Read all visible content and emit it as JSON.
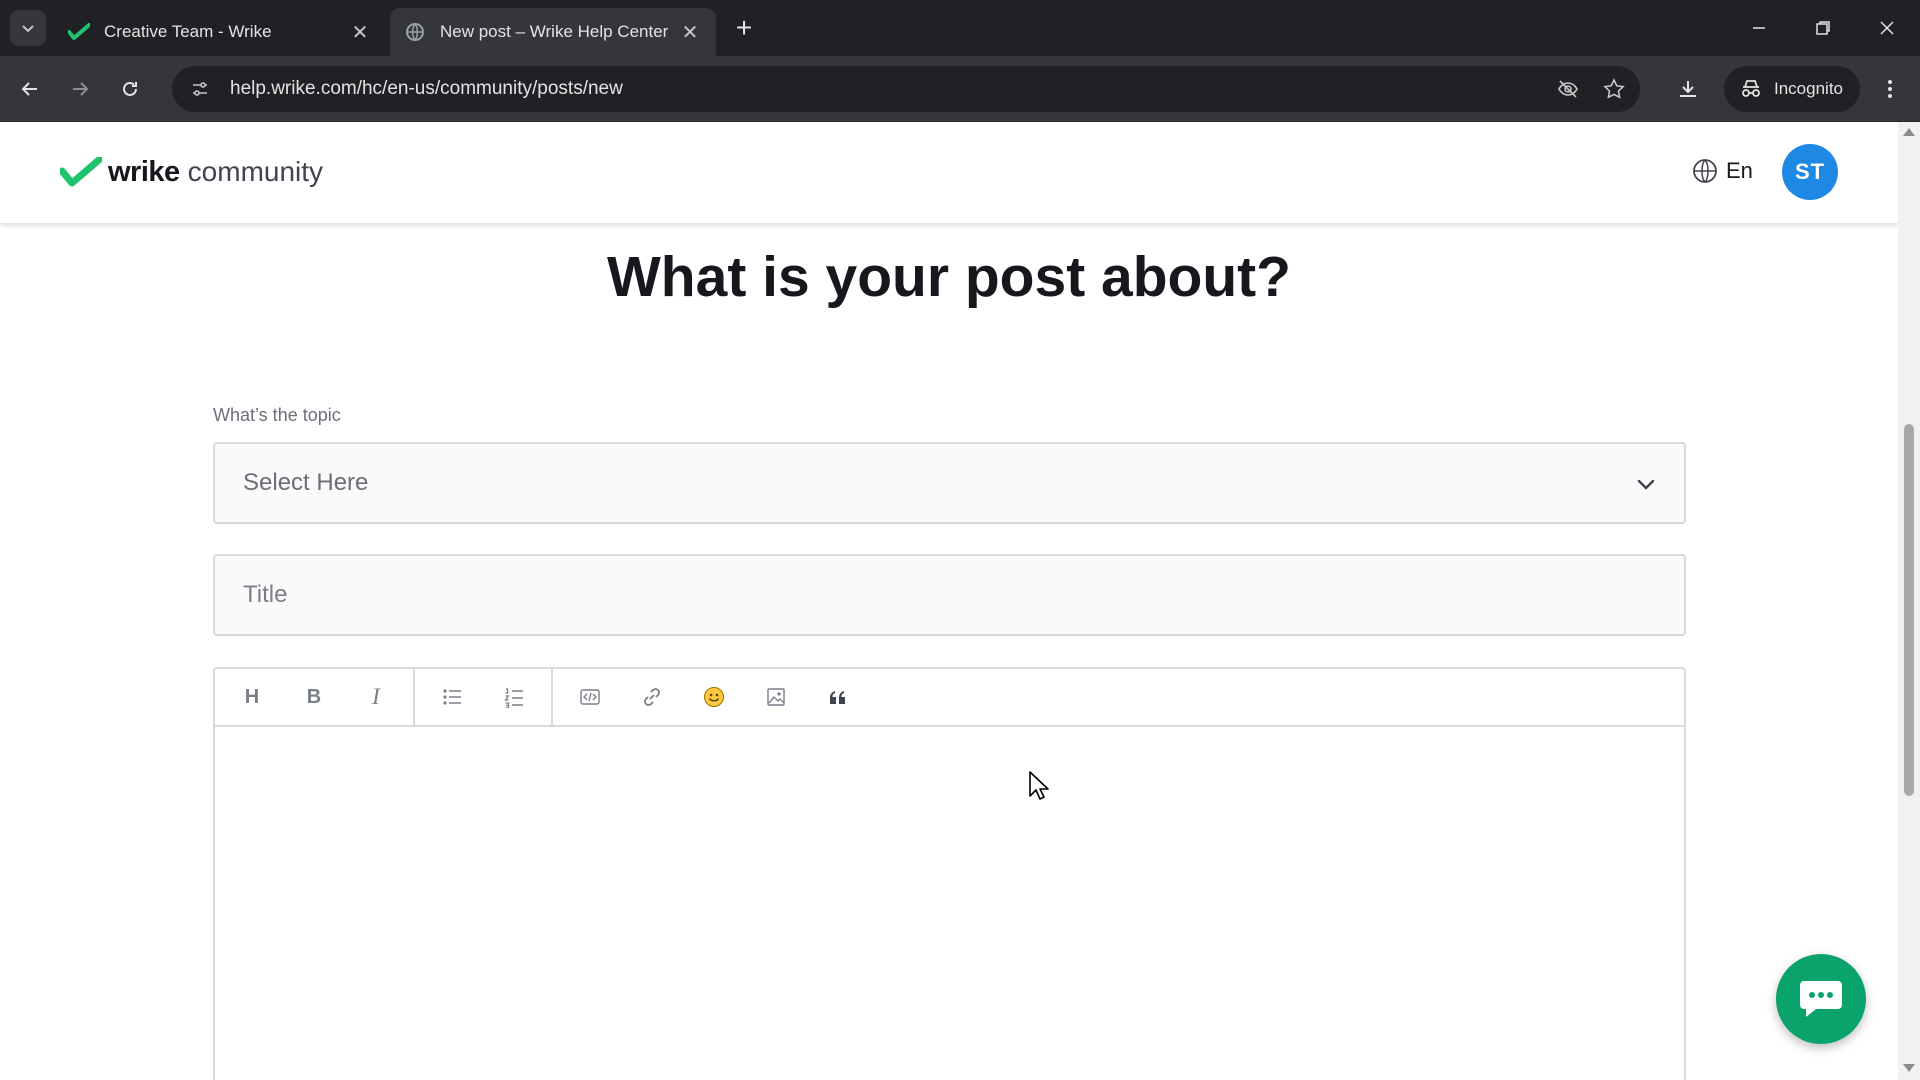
{
  "browser": {
    "tabs": [
      {
        "title": "Creative Team - Wrike",
        "active": false,
        "icon": "wrike-check-icon"
      },
      {
        "title": "New post – Wrike Help Center",
        "active": true,
        "icon": "globe-icon"
      }
    ],
    "url": "help.wrike.com/hc/en-us/community/posts/new",
    "incognito_label": "Incognito"
  },
  "header": {
    "brand": "wrike",
    "brand_sub": "community",
    "language": "En",
    "avatar_initials": "ST"
  },
  "page": {
    "heading": "What is your post about?",
    "topic_label": "What’s the topic",
    "topic_select_value": "Select Here",
    "title_placeholder": "Title"
  },
  "editor": {
    "toolbar_groups": [
      [
        "heading-icon",
        "bold-icon",
        "italic-icon"
      ],
      [
        "bulleted-list-icon",
        "numbered-list-icon"
      ],
      [
        "code-icon",
        "link-icon",
        "emoji-icon",
        "image-icon",
        "quote-icon"
      ]
    ],
    "heading_glyph": "H",
    "bold_glyph": "B",
    "italic_glyph": "I"
  },
  "colors": {
    "brand_green": "#09a36b",
    "avatar_blue": "#1e88e5",
    "heading_text": "#16181d"
  }
}
